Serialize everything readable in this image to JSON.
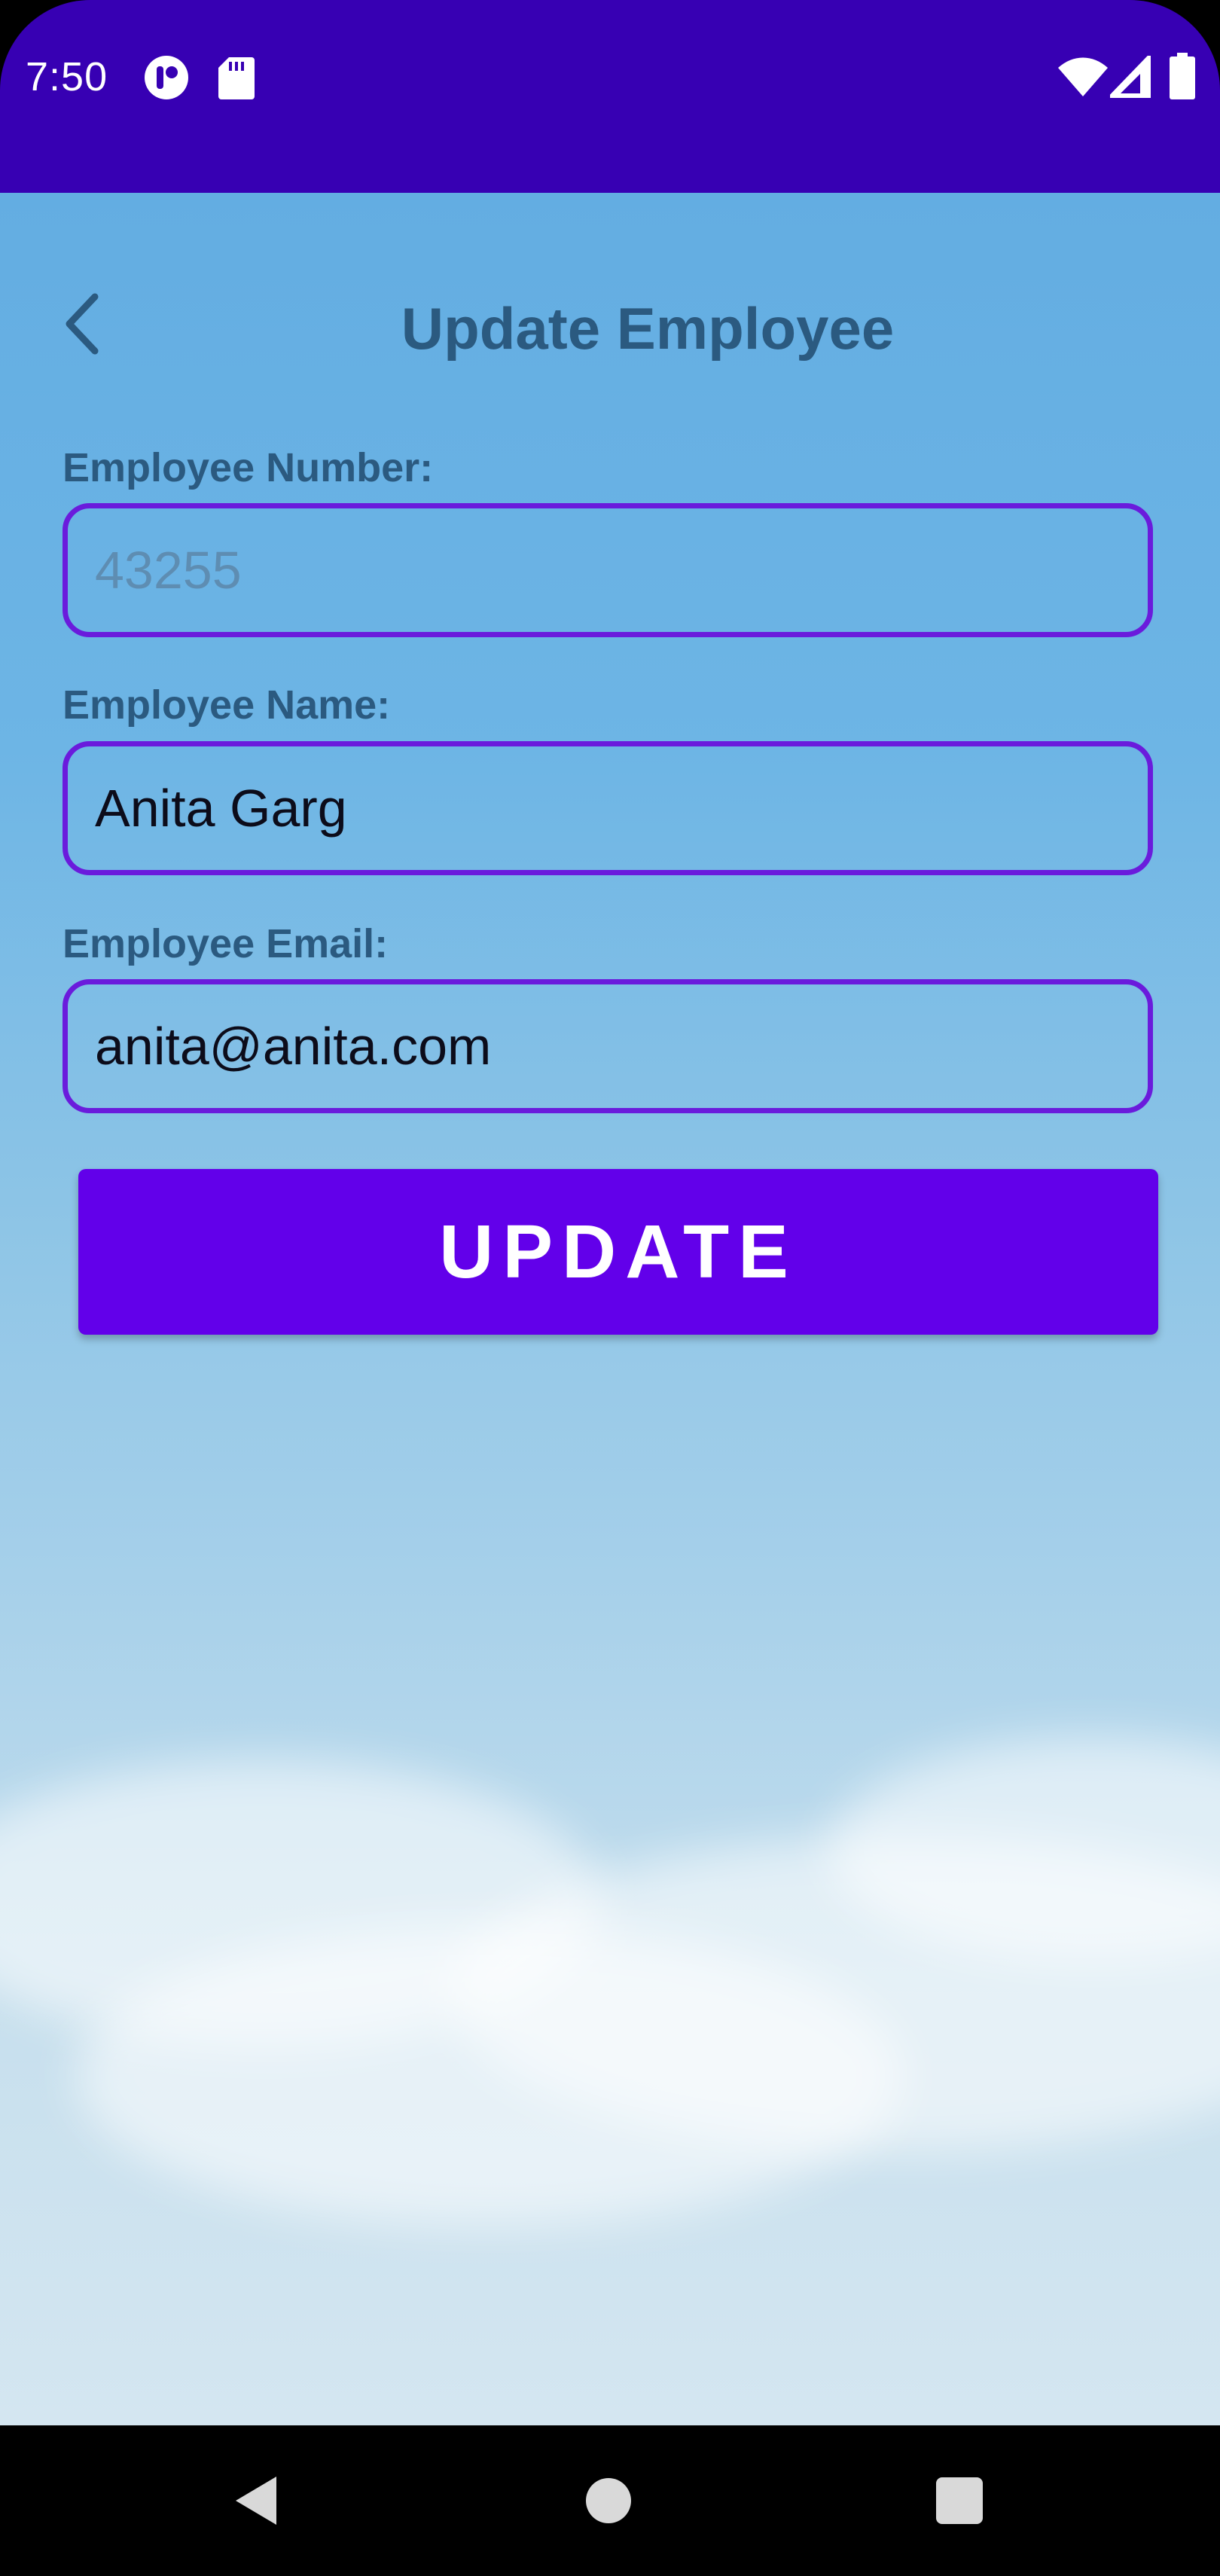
{
  "status_bar": {
    "time": "7:50",
    "left_icons": [
      "app-notification-icon",
      "sd-card-icon"
    ],
    "right_icons": [
      "wifi-icon",
      "cellular-signal-icon",
      "battery-icon"
    ],
    "color": "#3700b3"
  },
  "header": {
    "title": "Update Employee",
    "back_icon": "chevron-left-icon"
  },
  "form": {
    "employee_number": {
      "label": "Employee Number:",
      "value": "",
      "placeholder": "43255"
    },
    "employee_name": {
      "label": "Employee Name:",
      "value": "Anita Garg",
      "placeholder": ""
    },
    "employee_email": {
      "label": "Employee Email:",
      "value": "anita@anita.com",
      "placeholder": ""
    },
    "update_label": "UPDATE"
  },
  "nav_bar": {
    "buttons": [
      "back-triangle-icon",
      "home-circle-icon",
      "recents-square-icon"
    ]
  },
  "colors": {
    "accent": "#6200ea",
    "input_border": "#6a1bdc",
    "label_text": "#2b5a80"
  }
}
